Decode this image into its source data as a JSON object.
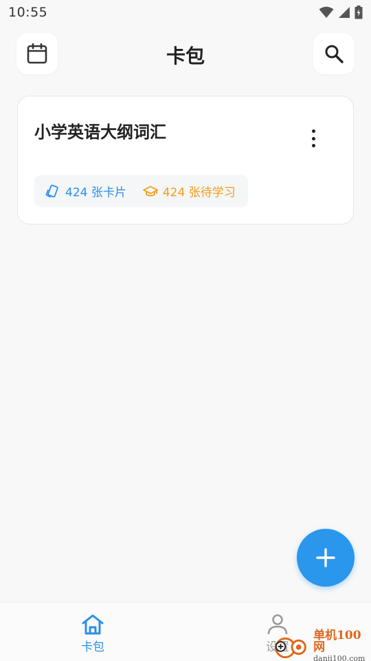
{
  "status_bar": {
    "time": "10:55",
    "icons": [
      "wifi-icon",
      "cellular-signal-icon",
      "battery-icon"
    ]
  },
  "header": {
    "title": "卡包",
    "left_icon": "calendar-icon",
    "right_icon": "search-icon"
  },
  "decks": [
    {
      "title": "小学英语大纲词汇",
      "cards_count_label": "424 张卡片",
      "pending_label": "424 张待学习",
      "menu_icon": "more-vertical-icon"
    }
  ],
  "fab": {
    "icon": "plus-icon"
  },
  "bottom_nav": {
    "items": [
      {
        "label": "卡包",
        "icon": "home-icon",
        "active": true
      },
      {
        "label": "设置",
        "icon": "person-icon",
        "active": false
      }
    ]
  },
  "watermark": {
    "main": "单机100网",
    "sub": "danji100.com"
  },
  "colors": {
    "accent": "#2a96ec",
    "orange": "#f39c12",
    "background": "#f8f8f8"
  }
}
